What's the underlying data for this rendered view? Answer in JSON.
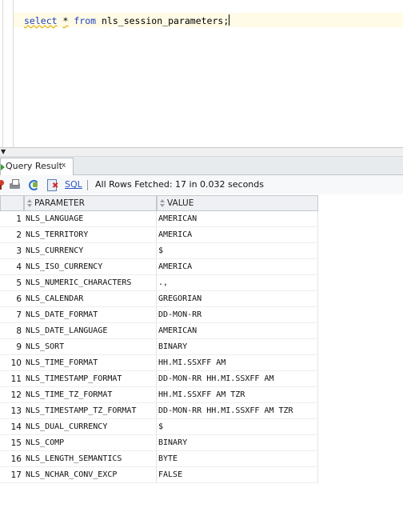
{
  "editor": {
    "sql_keyword_select": "select",
    "sql_star": "*",
    "sql_keyword_from": "from",
    "sql_rest": "nls_session_parameters;"
  },
  "tab": {
    "label": "Query Result",
    "close": "x"
  },
  "toolbar": {
    "sql_label": "SQL",
    "status": "All Rows Fetched: 17 in 0.032 seconds"
  },
  "grid": {
    "columns": [
      "PARAMETER",
      "VALUE"
    ],
    "rows": [
      {
        "num": "1",
        "parameter": "NLS_LANGUAGE",
        "value": "AMERICAN"
      },
      {
        "num": "2",
        "parameter": "NLS_TERRITORY",
        "value": "AMERICA"
      },
      {
        "num": "3",
        "parameter": "NLS_CURRENCY",
        "value": "$"
      },
      {
        "num": "4",
        "parameter": "NLS_ISO_CURRENCY",
        "value": "AMERICA"
      },
      {
        "num": "5",
        "parameter": "NLS_NUMERIC_CHARACTERS",
        "value": ".,"
      },
      {
        "num": "6",
        "parameter": "NLS_CALENDAR",
        "value": "GREGORIAN"
      },
      {
        "num": "7",
        "parameter": "NLS_DATE_FORMAT",
        "value": "DD-MON-RR"
      },
      {
        "num": "8",
        "parameter": "NLS_DATE_LANGUAGE",
        "value": "AMERICAN"
      },
      {
        "num": "9",
        "parameter": "NLS_SORT",
        "value": "BINARY"
      },
      {
        "num": "10",
        "parameter": "NLS_TIME_FORMAT",
        "value": "HH.MI.SSXFF AM"
      },
      {
        "num": "11",
        "parameter": "NLS_TIMESTAMP_FORMAT",
        "value": "DD-MON-RR HH.MI.SSXFF AM"
      },
      {
        "num": "12",
        "parameter": "NLS_TIME_TZ_FORMAT",
        "value": "HH.MI.SSXFF AM TZR"
      },
      {
        "num": "13",
        "parameter": "NLS_TIMESTAMP_TZ_FORMAT",
        "value": "DD-MON-RR HH.MI.SSXFF AM TZR"
      },
      {
        "num": "14",
        "parameter": "NLS_DUAL_CURRENCY",
        "value": "$"
      },
      {
        "num": "15",
        "parameter": "NLS_COMP",
        "value": "BINARY"
      },
      {
        "num": "16",
        "parameter": "NLS_LENGTH_SEMANTICS",
        "value": "BYTE"
      },
      {
        "num": "17",
        "parameter": "NLS_NCHAR_CONV_EXCP",
        "value": "FALSE"
      }
    ]
  }
}
